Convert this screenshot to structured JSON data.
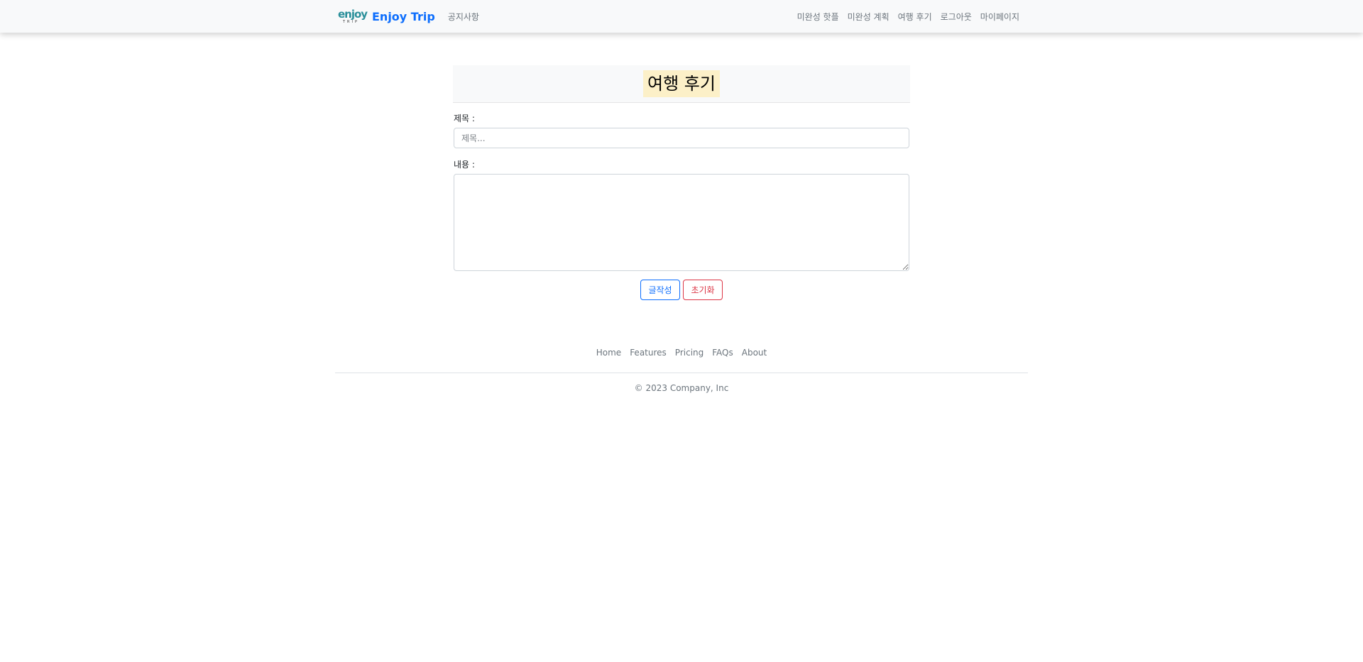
{
  "navbar": {
    "logo_word": "enjoy",
    "logo_sub": "TRIP",
    "brand": "Enjoy Trip",
    "notice": "공지사항",
    "right_links": [
      "미완성 핫플",
      "미완성 계획",
      "여행 후기",
      "로그아웃",
      "마이페이지"
    ]
  },
  "form": {
    "heading": "여행 후기",
    "title_label": "제목 :",
    "title_placeholder": "제목...",
    "title_value": "",
    "content_label": "내용 :",
    "content_value": "",
    "write_button": "글작성",
    "reset_button": "초기화"
  },
  "footer": {
    "links": [
      "Home",
      "Features",
      "Pricing",
      "FAQs",
      "About"
    ],
    "copyright": "© 2023 Company, Inc"
  },
  "colors": {
    "brand": "#0d6efd",
    "danger": "#dc3545",
    "navbar_bg": "#f8f9fa",
    "heading_highlight": "#fcf0c8"
  }
}
